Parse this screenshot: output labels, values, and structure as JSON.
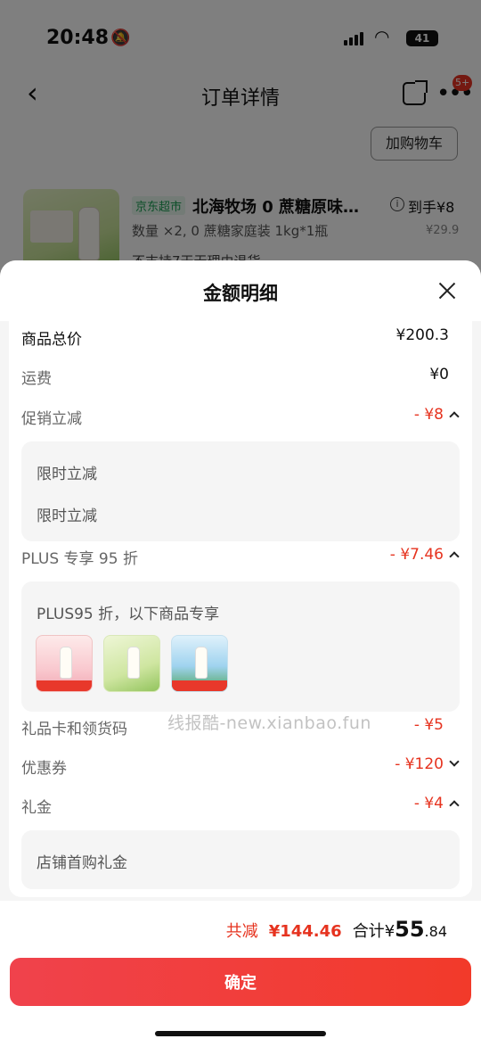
{
  "status": {
    "time": "20:48",
    "battery": "41"
  },
  "nav": {
    "title": "订单详情",
    "badge": "5+"
  },
  "bg": {
    "add_cart": "加购物车",
    "store_tag": "京东超市",
    "product_name": "北海牧场 0 蔗糖原味…",
    "to_hand": "到手¥8",
    "spec": "数量 ×2, 0 蔗糖家庭装 1kg*1瓶",
    "orig_price": "¥29.9",
    "no_return": "不支持7天无理由退货"
  },
  "sheet": {
    "title": "金额明细",
    "rows": {
      "goods_total": {
        "label": "商品总价",
        "amount": "¥200.3"
      },
      "shipping": {
        "label": "运费",
        "amount": "¥0"
      },
      "promo": {
        "label": "促销立减",
        "amount": "- ¥8",
        "items": [
          "限时立减",
          "限时立减"
        ]
      },
      "plus": {
        "label": "PLUS 专享 95 折",
        "amount": "- ¥7.46",
        "note": "PLUS95 折，以下商品专享",
        "thumb_prices": [
          "39.8",
          "",
          "22.9"
        ]
      },
      "gift_card": {
        "label": "礼品卡和领货码",
        "amount": "- ¥5"
      },
      "coupon": {
        "label": "优惠券",
        "amount": "- ¥120"
      },
      "cash_gift": {
        "label": "礼金",
        "amount": "- ¥4",
        "items": [
          "店铺首购礼金"
        ]
      }
    },
    "watermark": "线报酷-new.xianbao.fun"
  },
  "footer": {
    "saved_label": "共减",
    "saved_amount": "¥144.46",
    "total_label": "合计",
    "total_yen": "¥",
    "total_int": "55",
    "total_dec": ".84",
    "confirm": "确定"
  },
  "icons": [
    "mute-bell-icon",
    "signal-icon",
    "wifi-icon",
    "battery-icon",
    "back-icon",
    "share-icon",
    "more-icon",
    "close-icon",
    "chevron-up-icon",
    "chevron-down-icon",
    "info-icon"
  ],
  "colors": {
    "accent_red": "#e6331f",
    "button_red": "#f0424c",
    "store_green": "#1a9f53"
  }
}
